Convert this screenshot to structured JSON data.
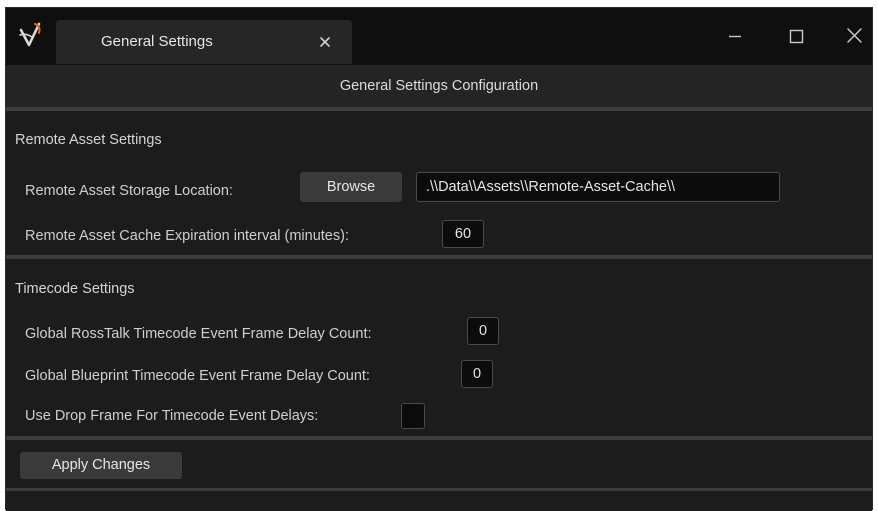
{
  "window": {
    "tab_title": "General Settings",
    "icons": {
      "logo": "app-logo-icon",
      "tab_close": "close-icon",
      "minimize": "minimize-icon",
      "maximize": "maximize-icon",
      "close": "close-icon"
    }
  },
  "header": {
    "title": "General Settings Configuration"
  },
  "remote_asset": {
    "section_title": "Remote Asset Settings",
    "storage_location_label": "Remote Asset Storage Location:",
    "browse_label": "Browse",
    "storage_location_value": ".\\\\Data\\\\Assets\\\\Remote-Asset-Cache\\\\",
    "cache_expiration_label": "Remote Asset Cache Expiration interval (minutes):",
    "cache_expiration_value": "60"
  },
  "timecode": {
    "section_title": "Timecode Settings",
    "rosstalk_delay_label": "Global RossTalk Timecode Event Frame Delay Count:",
    "rosstalk_delay_value": "0",
    "blueprint_delay_label": "Global Blueprint Timecode Event Frame Delay Count:",
    "blueprint_delay_value": "0",
    "drop_frame_label": "Use Drop Frame For Timecode Event Delays:",
    "drop_frame_checked": false
  },
  "footer": {
    "apply_label": "Apply Changes"
  },
  "colors": {
    "background": "#1c1c1c",
    "titlebar": "#0f0f0f",
    "accent_logo": "#e06a1a"
  }
}
